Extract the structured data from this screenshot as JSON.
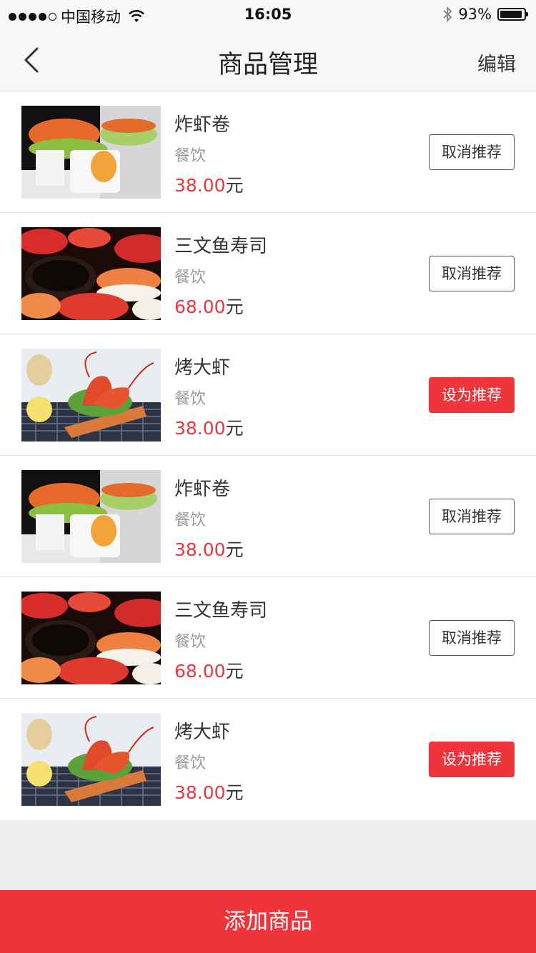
{
  "status": {
    "carrier": "中国移动",
    "time": "16:05",
    "battery_percent": "93%",
    "battery_level": 0.93,
    "icons": [
      "signal-dots-icon",
      "wifi-icon",
      "bluetooth-icon",
      "battery-icon"
    ]
  },
  "nav": {
    "title": "商品管理",
    "edit": "编辑",
    "back_icon": "chevron-left-icon"
  },
  "products": [
    {
      "name": "炸虾卷",
      "category": "餐饮",
      "price": "38.00",
      "unit": "元",
      "action": "取消推荐",
      "recommended": true,
      "image": "shrimp-roll"
    },
    {
      "name": "三文鱼寿司",
      "category": "餐饮",
      "price": "68.00",
      "unit": "元",
      "action": "取消推荐",
      "recommended": true,
      "image": "salmon-sushi"
    },
    {
      "name": "烤大虾",
      "category": "餐饮",
      "price": "38.00",
      "unit": "元",
      "action": "设为推荐",
      "recommended": false,
      "image": "grilled-prawn"
    },
    {
      "name": "炸虾卷",
      "category": "餐饮",
      "price": "38.00",
      "unit": "元",
      "action": "取消推荐",
      "recommended": true,
      "image": "shrimp-roll"
    },
    {
      "name": "三文鱼寿司",
      "category": "餐饮",
      "price": "68.00",
      "unit": "元",
      "action": "取消推荐",
      "recommended": true,
      "image": "salmon-sushi"
    },
    {
      "name": "烤大虾",
      "category": "餐饮",
      "price": "38.00",
      "unit": "元",
      "action": "设为推荐",
      "recommended": false,
      "image": "grilled-prawn"
    }
  ],
  "footer": {
    "add_label": "添加商品"
  },
  "colors": {
    "accent": "#f0343b",
    "background": "#efefef",
    "nav_background": "#f7f7f7"
  }
}
